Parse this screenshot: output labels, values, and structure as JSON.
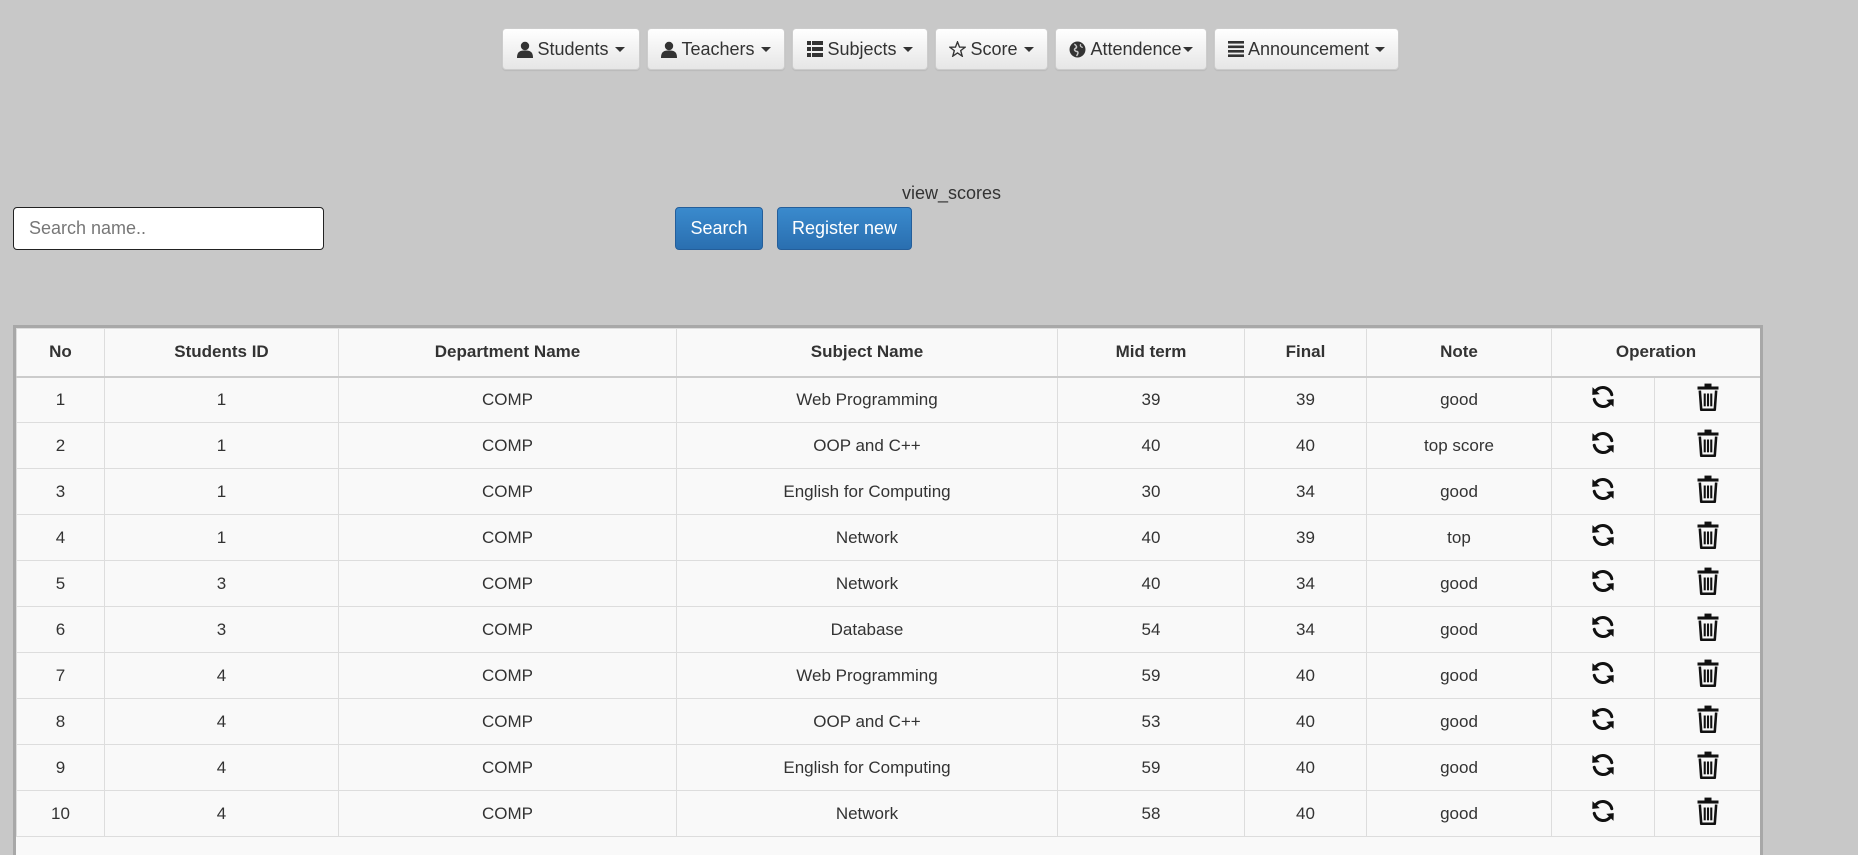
{
  "nav": {
    "items": [
      {
        "label": "Students",
        "icon": "user-icon"
      },
      {
        "label": "Teachers",
        "icon": "user-icon"
      },
      {
        "label": "Subjects",
        "icon": "list-icon"
      },
      {
        "label": "Score",
        "icon": "star-icon"
      },
      {
        "label": "Attendence",
        "icon": "globe-icon"
      },
      {
        "label": "Announcement",
        "icon": "menu-icon"
      }
    ]
  },
  "page": {
    "title": "view_scores"
  },
  "search": {
    "placeholder": "Search name..",
    "value": "",
    "button_label": "Search"
  },
  "register": {
    "button_label": "Register new"
  },
  "table": {
    "headers": [
      "No",
      "Students ID",
      "Department Name",
      "Subject Name",
      "Mid term",
      "Final",
      "Note",
      "Operation"
    ],
    "rows": [
      {
        "no": "1",
        "student_id": "1",
        "department": "COMP",
        "subject": "Web Programming",
        "mid": "39",
        "final": "39",
        "note": "good"
      },
      {
        "no": "2",
        "student_id": "1",
        "department": "COMP",
        "subject": "OOP and C++",
        "mid": "40",
        "final": "40",
        "note": "top score"
      },
      {
        "no": "3",
        "student_id": "1",
        "department": "COMP",
        "subject": "English for Computing",
        "mid": "30",
        "final": "34",
        "note": "good"
      },
      {
        "no": "4",
        "student_id": "1",
        "department": "COMP",
        "subject": "Network",
        "mid": "40",
        "final": "39",
        "note": "top"
      },
      {
        "no": "5",
        "student_id": "3",
        "department": "COMP",
        "subject": "Network",
        "mid": "40",
        "final": "34",
        "note": "good"
      },
      {
        "no": "6",
        "student_id": "3",
        "department": "COMP",
        "subject": "Database",
        "mid": "54",
        "final": "34",
        "note": "good"
      },
      {
        "no": "7",
        "student_id": "4",
        "department": "COMP",
        "subject": "Web Programming",
        "mid": "59",
        "final": "40",
        "note": "good"
      },
      {
        "no": "8",
        "student_id": "4",
        "department": "COMP",
        "subject": "OOP and C++",
        "mid": "53",
        "final": "40",
        "note": "good"
      },
      {
        "no": "9",
        "student_id": "4",
        "department": "COMP",
        "subject": "English for Computing",
        "mid": "59",
        "final": "40",
        "note": "good"
      },
      {
        "no": "10",
        "student_id": "4",
        "department": "COMP",
        "subject": "Network",
        "mid": "58",
        "final": "40",
        "note": "good"
      }
    ],
    "row_actions": [
      "refresh-icon",
      "trash-icon"
    ]
  }
}
